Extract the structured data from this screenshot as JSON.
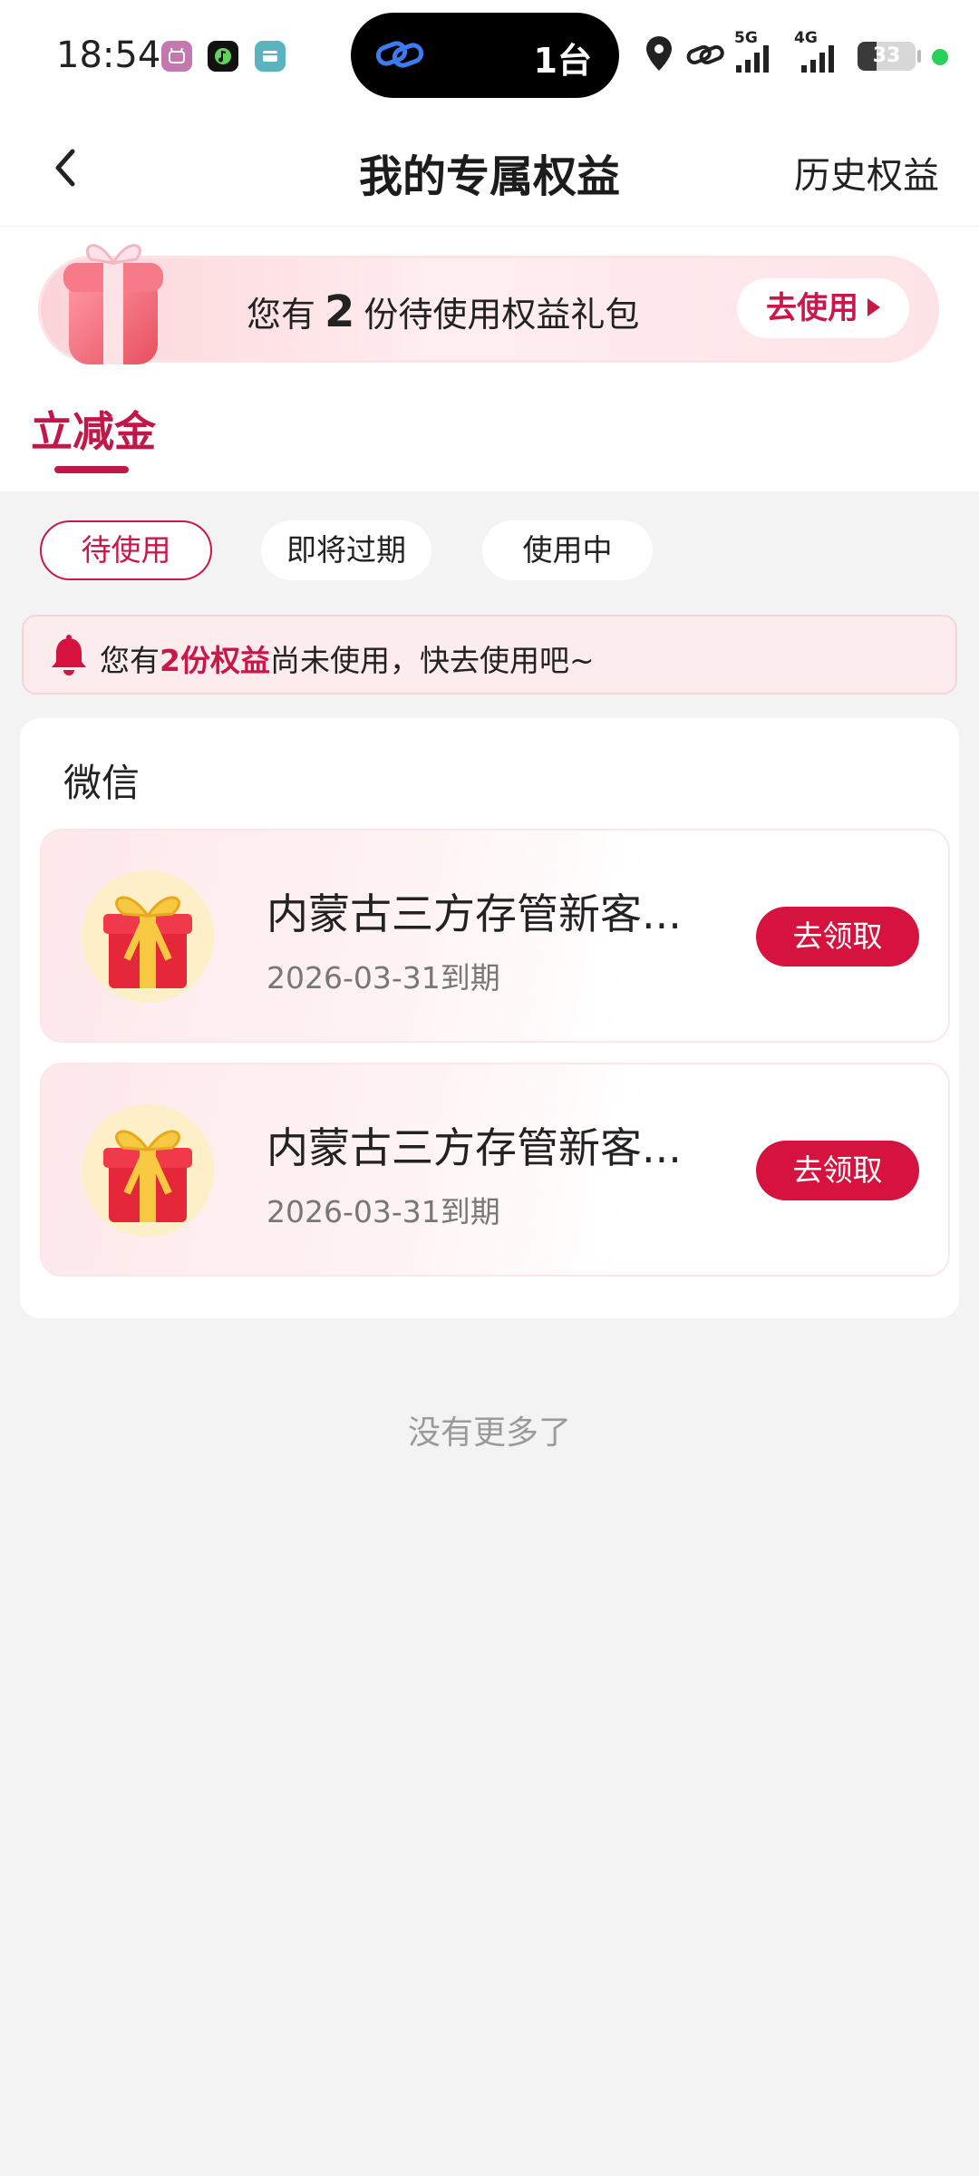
{
  "status_bar": {
    "time": "18:54",
    "island_text": "1台",
    "signal1_label": "5G",
    "signal2_label": "4G",
    "battery_level": "33",
    "icons": [
      "app-cat-icon",
      "app-music-icon",
      "app-card-icon",
      "link-icon",
      "location-icon",
      "link-icon",
      "signal-icon",
      "signal-icon",
      "battery-icon"
    ]
  },
  "header": {
    "title": "我的专属权益",
    "history_label": "历史权益"
  },
  "banner": {
    "text_before": "您有",
    "count": "2",
    "text_after": "份待使用权益礼包",
    "button_label": "去使用"
  },
  "tabs": [
    {
      "label": "立减金",
      "active": true
    }
  ],
  "filters": [
    {
      "label": "待使用",
      "active": true
    },
    {
      "label": "即将过期",
      "active": false
    },
    {
      "label": "使用中",
      "active": false
    }
  ],
  "notice": {
    "before": "您有",
    "highlight": "2份权益",
    "after": "尚未使用，快去使用吧~"
  },
  "section": {
    "title": "微信",
    "items": [
      {
        "name": "内蒙古三方存管新客...",
        "expiry": "2026-03-31到期",
        "button": "去领取"
      },
      {
        "name": "内蒙古三方存管新客...",
        "expiry": "2026-03-31到期",
        "button": "去领取"
      }
    ]
  },
  "footer": {
    "no_more": "没有更多了"
  },
  "colors": {
    "accent": "#c8184a",
    "button": "#d6123f",
    "background": "#f3f3f3"
  }
}
